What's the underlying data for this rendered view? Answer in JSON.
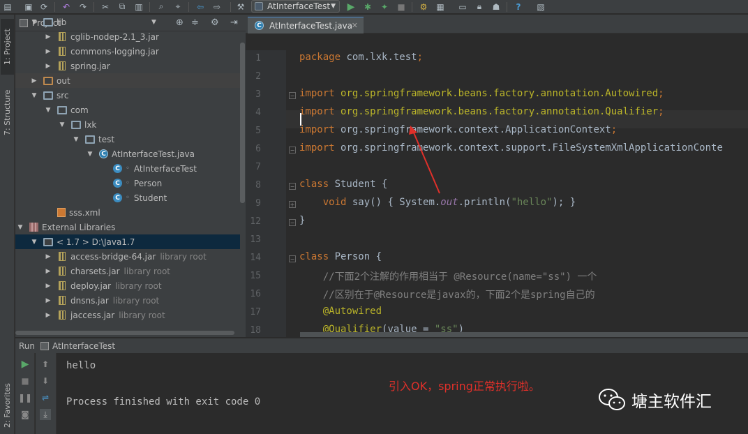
{
  "toolbar": {
    "run_config": "AtInterfaceTest",
    "buttons": [
      "save-all-icon",
      "sync-icon",
      "undo-icon",
      "redo-icon",
      "cut-icon",
      "copy-icon",
      "paste-icon",
      "find-icon",
      "replace-icon",
      "back-icon",
      "forward-icon",
      "run-icon",
      "debug-icon",
      "coverage-icon",
      "stop-icon",
      "project-structure-icon",
      "sdk-icon",
      "settings-icon",
      "android-icon",
      "help-icon",
      "plugin-icon"
    ]
  },
  "left_strip": {
    "project_tab": "1: Project",
    "structure_tab": "7: Structure",
    "favorites_tab": "2: Favorites"
  },
  "project_panel": {
    "title": "Project",
    "tree": [
      {
        "label": "lib",
        "icon": "folder-icon",
        "indent": 1,
        "arrow": "open"
      },
      {
        "label": "cglib-nodep-2.1_3.jar",
        "icon": "jar-icon",
        "indent": 2,
        "arrow": "closed"
      },
      {
        "label": "commons-logging.jar",
        "icon": "jar-icon",
        "indent": 2,
        "arrow": "closed"
      },
      {
        "label": "spring.jar",
        "icon": "jar-icon",
        "indent": 2,
        "arrow": "closed"
      },
      {
        "label": "out",
        "icon": "folder-orange-icon",
        "indent": 1,
        "arrow": "closed"
      },
      {
        "label": "src",
        "icon": "folder-icon",
        "indent": 1,
        "arrow": "open"
      },
      {
        "label": "com",
        "icon": "package-icon",
        "indent": 2,
        "arrow": "open"
      },
      {
        "label": "lxk",
        "icon": "package-icon",
        "indent": 3,
        "arrow": "open"
      },
      {
        "label": "test",
        "icon": "package-icon",
        "indent": 4,
        "arrow": "open"
      },
      {
        "label": "AtInterfaceTest.java",
        "icon": "java-file-icon",
        "indent": 5,
        "arrow": "open"
      },
      {
        "label": "AtInterfaceTest",
        "icon": "class-icon",
        "indent": 6,
        "arrow": "none"
      },
      {
        "label": "Person",
        "icon": "class-icon",
        "indent": 6,
        "arrow": "none"
      },
      {
        "label": "Student",
        "icon": "class-icon",
        "indent": 6,
        "arrow": "none"
      },
      {
        "label": "sss.xml",
        "icon": "xml-icon",
        "indent": 2,
        "arrow": "none"
      },
      {
        "label": "External Libraries",
        "icon": "library-icon",
        "indent": 0,
        "arrow": "open"
      },
      {
        "label": "< 1.7 >  D:\\Java1.7",
        "icon": "sdk-folder-icon",
        "indent": 1,
        "arrow": "open"
      },
      {
        "label": "access-bridge-64.jar",
        "suffix": "library root",
        "icon": "jar-icon",
        "indent": 2,
        "arrow": "closed"
      },
      {
        "label": "charsets.jar",
        "suffix": "library root",
        "icon": "jar-icon",
        "indent": 2,
        "arrow": "closed"
      },
      {
        "label": "deploy.jar",
        "suffix": "library root",
        "icon": "jar-icon",
        "indent": 2,
        "arrow": "closed"
      },
      {
        "label": "dnsns.jar",
        "suffix": "library root",
        "icon": "jar-icon",
        "indent": 2,
        "arrow": "closed"
      },
      {
        "label": "jaccess.jar",
        "suffix": "library root",
        "icon": "jar-icon",
        "indent": 2,
        "arrow": "closed"
      }
    ]
  },
  "editor": {
    "tab_label": "AtInterfaceTest.java",
    "line_numbers": [
      "1",
      "2",
      "3",
      "4",
      "5",
      "6",
      "7",
      "8",
      "9",
      "12",
      "13",
      "14",
      "15",
      "16",
      "17",
      "18"
    ],
    "lines": [
      {
        "parts": [
          {
            "t": "package ",
            "c": "kw"
          },
          {
            "t": "com.lxk.test",
            "c": "pkg"
          },
          {
            "t": ";",
            "c": "kw"
          }
        ]
      },
      {
        "parts": []
      },
      {
        "parts": [
          {
            "t": "import ",
            "c": "kw"
          },
          {
            "t": "org.springframework.beans.factory.annotation.Autowired",
            "c": "ann"
          },
          {
            "t": ";",
            "c": "kw"
          }
        ]
      },
      {
        "parts": [
          {
            "t": "import ",
            "c": "kw"
          },
          {
            "t": "org.springframework.beans.factory.annotation.Qualifier",
            "c": "ann"
          },
          {
            "t": ";",
            "c": "kw"
          }
        ]
      },
      {
        "parts": [
          {
            "t": "import ",
            "c": "kw"
          },
          {
            "t": "org.springframework.context.ApplicationContext",
            "c": "pkg"
          },
          {
            "t": ";",
            "c": "kw"
          }
        ]
      },
      {
        "parts": [
          {
            "t": "import ",
            "c": "kw"
          },
          {
            "t": "org.springframework.context.support.FileSystemXmlApplicationConte",
            "c": "pkg"
          }
        ]
      },
      {
        "parts": []
      },
      {
        "parts": [
          {
            "t": "class ",
            "c": "kw"
          },
          {
            "t": "Student {",
            "c": "pkg"
          }
        ]
      },
      {
        "parts": [
          {
            "t": "    void ",
            "c": "kw"
          },
          {
            "t": "say() ",
            "c": "pkg"
          },
          {
            "t": "{ System.",
            "c": "pkg"
          },
          {
            "t": "out",
            "c": "ital"
          },
          {
            "t": ".println(",
            "c": "pkg"
          },
          {
            "t": "\"hello\"",
            "c": "str"
          },
          {
            "t": "); }",
            "c": "pkg"
          }
        ]
      },
      {
        "parts": [
          {
            "t": "}",
            "c": "pkg"
          }
        ]
      },
      {
        "parts": []
      },
      {
        "parts": [
          {
            "t": "class ",
            "c": "kw"
          },
          {
            "t": "Person {",
            "c": "pkg"
          }
        ]
      },
      {
        "parts": [
          {
            "t": "    //下面2个注解的作用相当于 @Resource(name=\"ss\") 一个",
            "c": "cmt"
          }
        ]
      },
      {
        "parts": [
          {
            "t": "    //区别在于@Resource是javax的，下面2个是spring自己的",
            "c": "cmt"
          }
        ]
      },
      {
        "parts": [
          {
            "t": "    @Autowired",
            "c": "ann"
          }
        ]
      },
      {
        "parts": [
          {
            "t": "    @Qualifier",
            "c": "ann"
          },
          {
            "t": "(value = ",
            "c": "pkg"
          },
          {
            "t": "\"ss\"",
            "c": "str"
          },
          {
            "t": ")",
            "c": "pkg"
          }
        ]
      }
    ]
  },
  "run_panel": {
    "title": "Run",
    "config": "AtInterfaceTest",
    "output": [
      "hello",
      "Process finished with exit code 0"
    ],
    "annotation": "引入OK，spring正常执行啦。",
    "watermark": "塘主软件汇"
  },
  "colors": {
    "background": "#2b2b2b",
    "panel": "#3c3f41",
    "keyword": "#cc7832",
    "annotation": "#bbb529",
    "string": "#6a8759",
    "comment": "#808080",
    "selection": "#0d293e",
    "annotation_red": "#e0302a"
  }
}
